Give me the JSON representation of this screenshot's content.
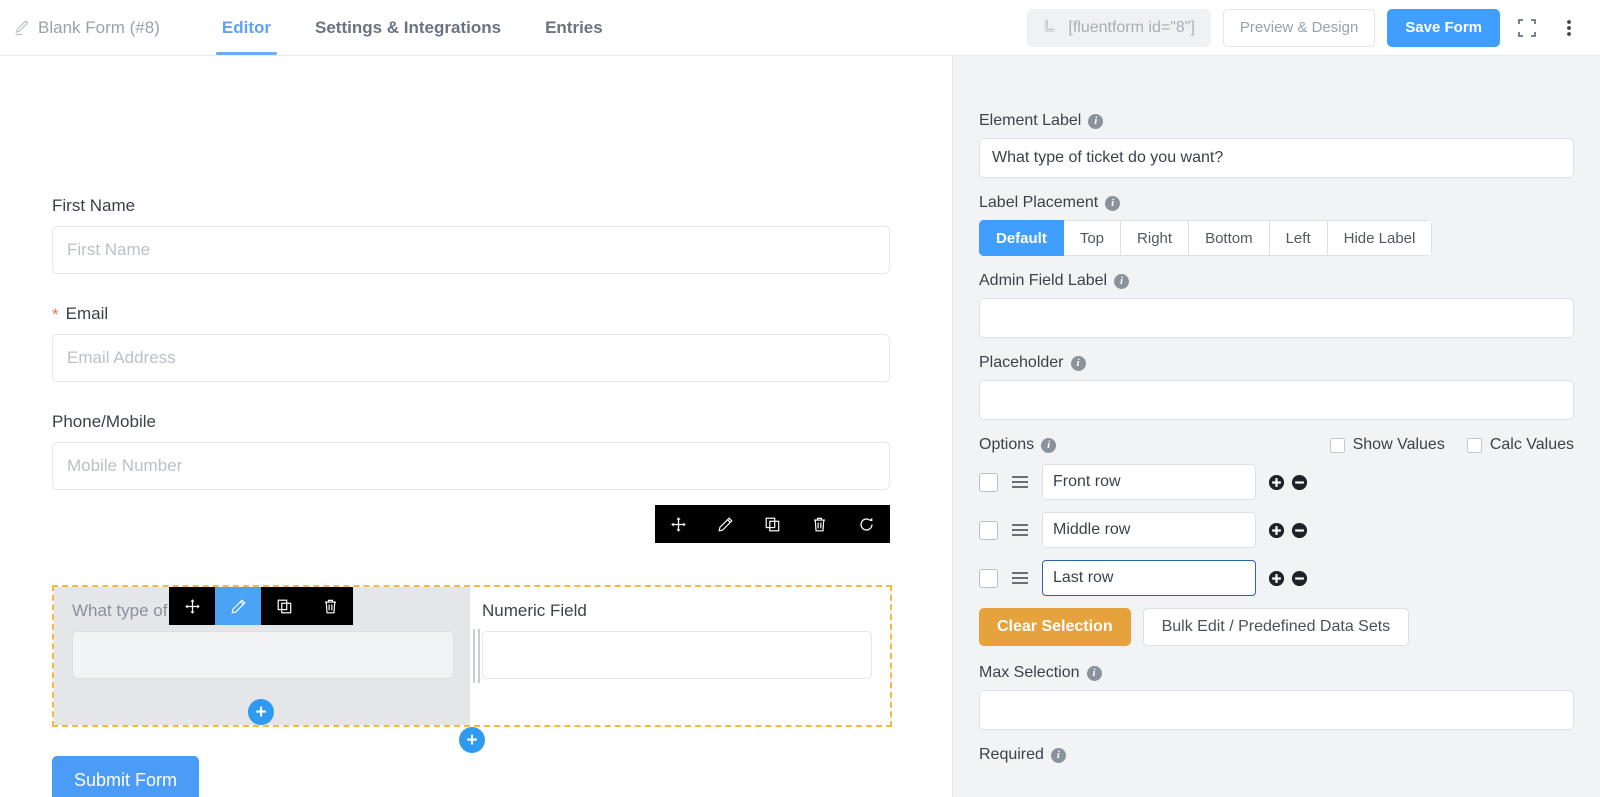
{
  "topbar": {
    "form_name": "Blank Form (#8)",
    "pencil_icon": "pencil-icon",
    "tabs": [
      {
        "label": "Editor",
        "active": true
      },
      {
        "label": "Settings & Integrations",
        "active": false
      },
      {
        "label": "Entries",
        "active": false
      }
    ],
    "shortcode": "[fluentform id=\"8\"]",
    "shortcode_icon": "shortcode-icon",
    "preview_label": "Preview & Design",
    "save_label": "Save Form",
    "fullscreen_icon": "fullscreen-icon",
    "more_icon": "more-vertical-icon",
    "accent_blue": "#409eff"
  },
  "canvas": {
    "fields": [
      {
        "label": "First Name",
        "required": false,
        "placeholder": "First Name"
      },
      {
        "label": "Email",
        "required": true,
        "placeholder": "Email Address"
      },
      {
        "label": "Phone/Mobile",
        "required": false,
        "placeholder": "Mobile Number"
      }
    ],
    "required_star": "*",
    "selected_container": {
      "left_column": {
        "label": "What type of ticket do you want?",
        "placeholder": ""
      },
      "right_column": {
        "label": "Numeric Field",
        "placeholder": ""
      },
      "border_color": "#f5b942"
    },
    "outer_toolbar": [
      {
        "name": "move-icon"
      },
      {
        "name": "edit-icon"
      },
      {
        "name": "duplicate-icon"
      },
      {
        "name": "delete-icon"
      },
      {
        "name": "reset-icon"
      }
    ],
    "inner_toolbar": [
      {
        "name": "move-icon",
        "active": false
      },
      {
        "name": "edit-icon",
        "active": true
      },
      {
        "name": "duplicate-icon",
        "active": false
      },
      {
        "name": "delete-icon",
        "active": false
      }
    ],
    "add_button_label": "+",
    "submit_label": "Submit Form"
  },
  "panel": {
    "element_label": {
      "label": "Element Label",
      "value": "What type of ticket do you want?"
    },
    "label_placement": {
      "label": "Label Placement",
      "options": [
        "Default",
        "Top",
        "Right",
        "Bottom",
        "Left",
        "Hide Label"
      ],
      "selected": "Default"
    },
    "admin_field_label": {
      "label": "Admin Field Label",
      "value": ""
    },
    "placeholder": {
      "label": "Placeholder",
      "value": ""
    },
    "options_section": {
      "label": "Options",
      "show_values_label": "Show Values",
      "show_values_checked": false,
      "calc_values_label": "Calc Values",
      "calc_values_checked": false,
      "rows": [
        {
          "value": "Front row",
          "checked": false,
          "focused": false
        },
        {
          "value": "Middle row",
          "checked": false,
          "focused": false
        },
        {
          "value": "Last row",
          "checked": false,
          "focused": true
        }
      ],
      "add_icon": "add-circle-icon",
      "remove_icon": "remove-circle-icon"
    },
    "clear_selection_label": "Clear Selection",
    "bulk_edit_label": "Bulk Edit / Predefined Data Sets",
    "max_selection": {
      "label": "Max Selection",
      "value": ""
    },
    "required": {
      "label": "Required"
    },
    "warn_color": "#e6a23c"
  }
}
